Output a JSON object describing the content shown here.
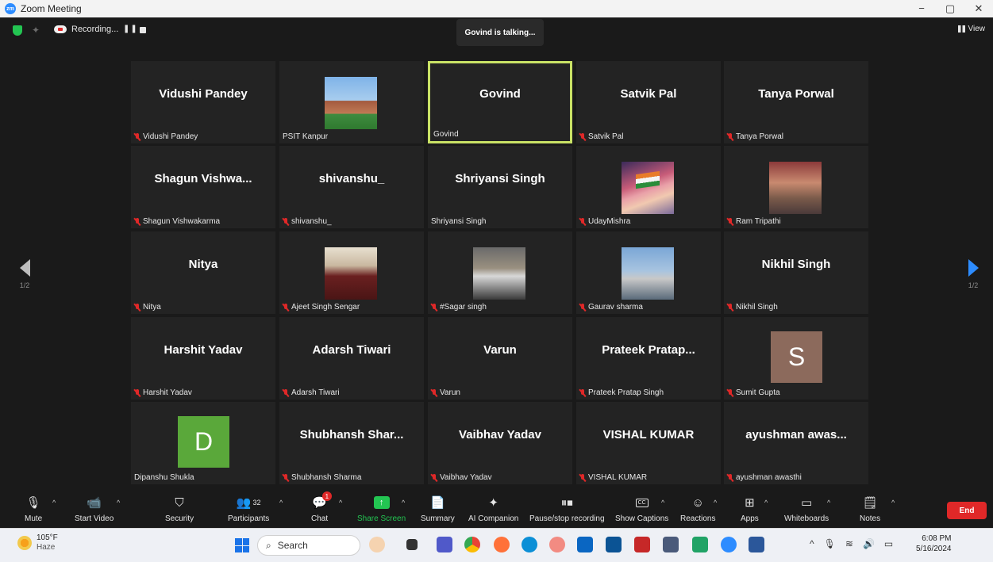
{
  "window": {
    "title": "Zoom Meeting",
    "minimize": "−",
    "maximize": "▢",
    "close": "✕"
  },
  "topbar": {
    "recording_label": "Recording...",
    "pause_glyph": "❚❚",
    "talking": "Govind is talking...",
    "view_label": "View"
  },
  "pager": {
    "left": "1/2",
    "right": "1/2"
  },
  "tiles": [
    {
      "big": "Vidushi Pandey",
      "name": "Vidushi Pandey",
      "muted": true,
      "type": "text"
    },
    {
      "big": "",
      "name": "PSIT Kanpur",
      "muted": false,
      "type": "pic",
      "pic": "college"
    },
    {
      "big": "Govind",
      "name": "Govind",
      "muted": false,
      "type": "text",
      "active": true
    },
    {
      "big": "Satvik Pal",
      "name": "Satvik Pal",
      "muted": true,
      "type": "text"
    },
    {
      "big": "Tanya Porwal",
      "name": "Tanya Porwal",
      "muted": true,
      "type": "text"
    },
    {
      "big": "Shagun Vishwa...",
      "name": "Shagun Vishwakarma",
      "muted": true,
      "type": "text"
    },
    {
      "big": "shivanshu_",
      "name": "shivanshu_",
      "muted": true,
      "type": "text"
    },
    {
      "big": "Shriyansi Singh",
      "name": "Shriyansi Singh",
      "muted": false,
      "type": "text"
    },
    {
      "big": "",
      "name": "UdayMishra",
      "muted": true,
      "type": "pic",
      "pic": "flag"
    },
    {
      "big": "",
      "name": "Ram Tripathi",
      "muted": true,
      "type": "pic",
      "pic": "ram"
    },
    {
      "big": "Nitya",
      "name": "Nitya",
      "muted": true,
      "type": "text"
    },
    {
      "big": "",
      "name": "Ajeet Singh Sengar",
      "muted": true,
      "type": "pic",
      "pic": "ajeet"
    },
    {
      "big": "",
      "name": "#Sagar singh",
      "muted": true,
      "type": "pic",
      "pic": "sagar"
    },
    {
      "big": "",
      "name": "Gaurav sharma",
      "muted": true,
      "type": "pic",
      "pic": "gaurav"
    },
    {
      "big": "Nikhil Singh",
      "name": "Nikhil Singh",
      "muted": true,
      "type": "text"
    },
    {
      "big": "Harshit Yadav",
      "name": "Harshit Yadav",
      "muted": true,
      "type": "text"
    },
    {
      "big": "Adarsh Tiwari",
      "name": "Adarsh Tiwari",
      "muted": true,
      "type": "text"
    },
    {
      "big": "Varun",
      "name": "Varun",
      "muted": true,
      "type": "text"
    },
    {
      "big": "Prateek Pratap...",
      "name": "Prateek Pratap Singh",
      "muted": true,
      "type": "text"
    },
    {
      "big": "S",
      "name": "Sumit Gupta",
      "muted": true,
      "type": "letter",
      "color": "#8c6a5c"
    },
    {
      "big": "D",
      "name": "Dipanshu Shukla",
      "muted": false,
      "type": "letter",
      "color": "#5aa83a"
    },
    {
      "big": "Shubhansh Shar...",
      "name": "Shubhansh Sharma",
      "muted": true,
      "type": "text"
    },
    {
      "big": "Vaibhav Yadav",
      "name": "Vaibhav Yadav",
      "muted": true,
      "type": "text"
    },
    {
      "big": "VISHAL KUMAR",
      "name": "VISHAL KUMAR",
      "muted": true,
      "type": "text"
    },
    {
      "big": "ayushman awas...",
      "name": "ayushman awasthi",
      "muted": true,
      "type": "text"
    }
  ],
  "toolbar": {
    "mute": "Mute",
    "start_video": "Start Video",
    "security": "Security",
    "participants": "Participants",
    "participants_count": "32",
    "chat": "Chat",
    "chat_badge": "1",
    "share_screen": "Share Screen",
    "summary": "Summary",
    "ai_companion": "AI Companion",
    "pause_recording": "Pause/stop recording",
    "show_captions": "Show Captions",
    "cc": "CC",
    "reactions": "Reactions",
    "apps": "Apps",
    "whiteboards": "Whiteboards",
    "notes": "Notes",
    "end": "End"
  },
  "taskbar": {
    "temp": "105°F",
    "weather": "Haze",
    "search": "Search",
    "time": "6:08 PM",
    "date": "5/16/2024"
  },
  "colors": {
    "accent_blue": "#2d8cff",
    "active_border": "#c9e265",
    "muted_red": "#e02828",
    "share_green": "#23c552",
    "end_red": "#e02828"
  }
}
